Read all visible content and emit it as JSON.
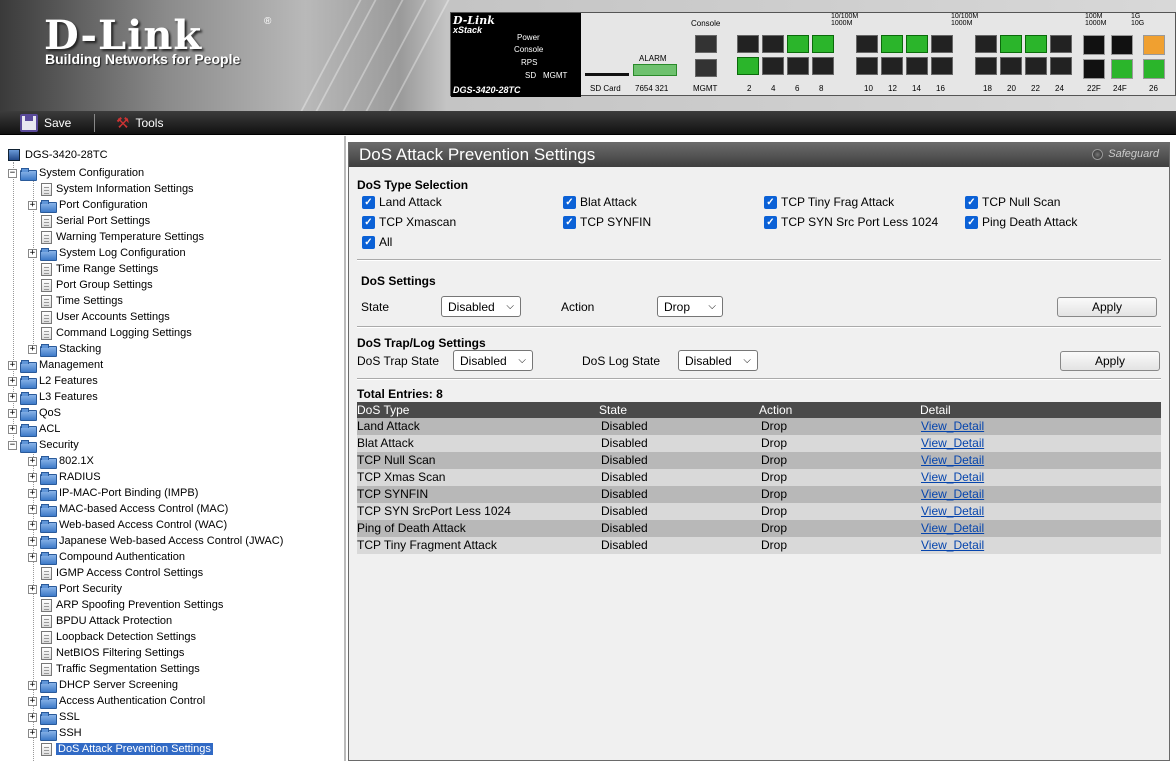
{
  "banner": {
    "logo": "D-Link",
    "tagline": "Building Networks for People",
    "device": {
      "brand": "D-Link",
      "series": "xStack",
      "model": "DGS-3420-28TC",
      "leds": [
        "Power",
        "Console",
        "RPS",
        "SD",
        "MGMT"
      ],
      "console_label": "Console",
      "alarm_label": "ALARM",
      "sdcard_label": "SD Card",
      "sdcard_pins": "7654 321",
      "mgmt_label": "MGMT",
      "speed_labels": [
        "10/100M",
        "1000M",
        "10/100M",
        "1000M",
        "100M",
        "1000M",
        "1G",
        "10G"
      ],
      "port_numbers": [
        "2",
        "4",
        "6",
        "8",
        "10",
        "12",
        "14",
        "16",
        "18",
        "20",
        "22",
        "24",
        "22F",
        "24F",
        "26"
      ]
    }
  },
  "toolbar": {
    "save_label": "Save",
    "tools_label": "Tools"
  },
  "tree": {
    "root": "DGS-3420-28TC",
    "system_configuration": "System Configuration",
    "system_children": [
      "System Information Settings",
      "Port Configuration",
      "Serial Port Settings",
      "Warning Temperature Settings",
      "System Log Configuration",
      "Time Range Settings",
      "Port Group Settings",
      "Time Settings",
      "User Accounts Settings",
      "Command Logging Settings",
      "Stacking"
    ],
    "management": "Management",
    "l2": "L2 Features",
    "l3": "L3 Features",
    "qos": "QoS",
    "acl": "ACL",
    "security": "Security",
    "security_children": [
      "802.1X",
      "RADIUS",
      "IP-MAC-Port Binding (IMPB)",
      "MAC-based Access Control (MAC)",
      "Web-based Access Control (WAC)",
      "Japanese Web-based Access Control (JWAC)",
      "Compound Authentication",
      "IGMP Access Control Settings",
      "Port Security",
      "ARP Spoofing Prevention Settings",
      "BPDU Attack Protection",
      "Loopback Detection Settings",
      "NetBIOS Filtering Settings",
      "Traffic Segmentation Settings",
      "DHCP Server Screening",
      "Access Authentication Control",
      "SSL",
      "SSH",
      "DoS Attack Prevention Settings"
    ]
  },
  "main": {
    "title": "DoS Attack Prevention Settings",
    "safeguard": "Safeguard",
    "type_selection": {
      "title": "DoS Type Selection",
      "items": [
        "Land Attack",
        "Blat Attack",
        "TCP Tiny Frag Attack",
        "TCP Null Scan",
        "TCP Xmascan",
        "TCP SYNFIN",
        "TCP SYN Src Port Less 1024",
        "Ping Death Attack",
        "All"
      ]
    },
    "dos_settings": {
      "title": "DoS Settings",
      "state_label": "State",
      "state_value": "Disabled",
      "action_label": "Action",
      "action_value": "Drop",
      "apply": "Apply"
    },
    "trap_log": {
      "title": "DoS Trap/Log Settings",
      "trap_label": "DoS Trap State",
      "trap_value": "Disabled",
      "log_label": "DoS Log State",
      "log_value": "Disabled",
      "apply": "Apply"
    },
    "table": {
      "total": "Total Entries: 8",
      "headers": [
        "DoS Type",
        "State",
        "Action",
        "Detail"
      ],
      "rows": [
        {
          "type": "Land Attack",
          "state": "Disabled",
          "action": "Drop",
          "detail": "View_Detail"
        },
        {
          "type": "Blat Attack",
          "state": "Disabled",
          "action": "Drop",
          "detail": "View_Detail"
        },
        {
          "type": "TCP Null Scan",
          "state": "Disabled",
          "action": "Drop",
          "detail": "View_Detail"
        },
        {
          "type": "TCP Xmas Scan",
          "state": "Disabled",
          "action": "Drop",
          "detail": "View_Detail"
        },
        {
          "type": "TCP SYNFIN",
          "state": "Disabled",
          "action": "Drop",
          "detail": "View_Detail"
        },
        {
          "type": "TCP SYN SrcPort Less 1024",
          "state": "Disabled",
          "action": "Drop",
          "detail": "View_Detail"
        },
        {
          "type": "Ping of Death Attack",
          "state": "Disabled",
          "action": "Drop",
          "detail": "View_Detail"
        },
        {
          "type": "TCP Tiny Fragment Attack",
          "state": "Disabled",
          "action": "Drop",
          "detail": "View_Detail"
        }
      ]
    }
  }
}
